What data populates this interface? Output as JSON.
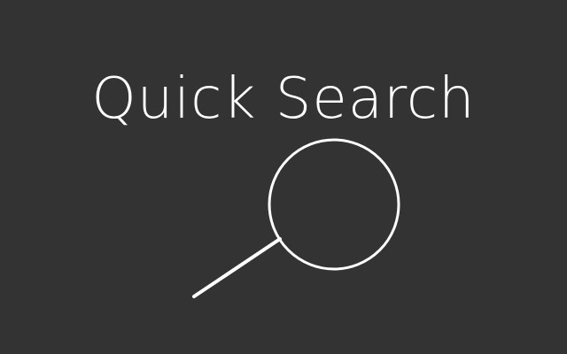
{
  "header": {
    "title": "Quick Search"
  },
  "icons": {
    "primary": "magnifying-glass-icon"
  },
  "colors": {
    "background": "#333333",
    "foreground": "#ffffff"
  }
}
